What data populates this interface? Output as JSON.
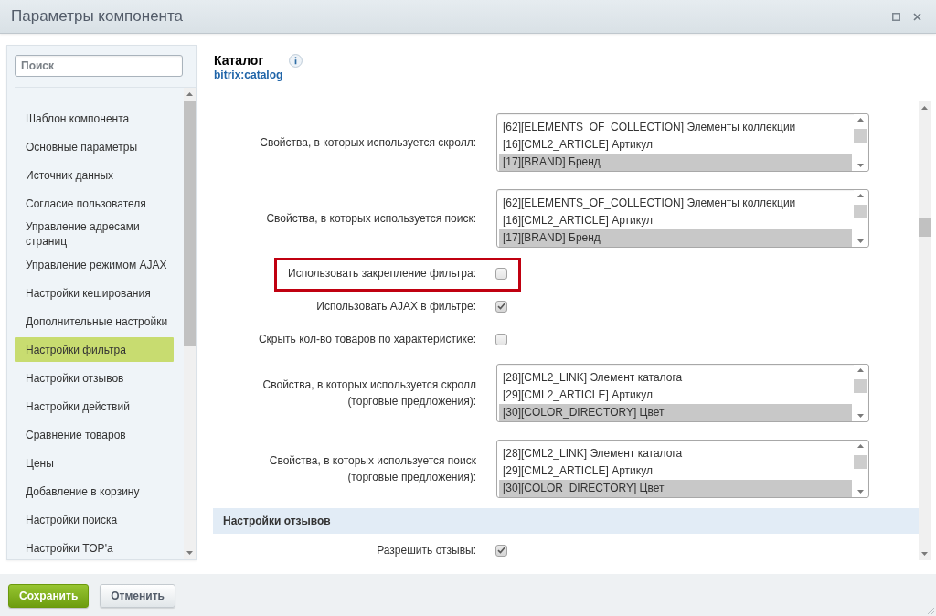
{
  "window": {
    "title": "Параметры компонента"
  },
  "sidebar": {
    "search": {
      "placeholder": "Поиск"
    },
    "items": [
      {
        "label": "Шаблон компонента",
        "selected": false
      },
      {
        "label": "Основные параметры",
        "selected": false
      },
      {
        "label": "Источник данных",
        "selected": false
      },
      {
        "label": "Согласие пользователя",
        "selected": false
      },
      {
        "label": "Управление адресами страниц",
        "selected": false
      },
      {
        "label": "Управление режимом AJAX",
        "selected": false
      },
      {
        "label": "Настройки кеширования",
        "selected": false
      },
      {
        "label": "Дополнительные настройки",
        "selected": false
      },
      {
        "label": "Настройки фильтра",
        "selected": true
      },
      {
        "label": "Настройки отзывов",
        "selected": false
      },
      {
        "label": "Настройки действий",
        "selected": false
      },
      {
        "label": "Сравнение товаров",
        "selected": false
      },
      {
        "label": "Цены",
        "selected": false
      },
      {
        "label": "Добавление в корзину",
        "selected": false
      },
      {
        "label": "Настройки поиска",
        "selected": false
      },
      {
        "label": "Настройки TOP'a",
        "selected": false
      }
    ]
  },
  "header": {
    "title": "Каталог",
    "code": "bitrix:catalog"
  },
  "settings": [
    {
      "kind": "listbox",
      "label": "Свойства, в которых используется скролл:",
      "highlighted": false,
      "options": [
        {
          "text": "[62][ELEMENTS_OF_COLLECTION] Элементы коллекции",
          "selected": false
        },
        {
          "text": "[16][CML2_ARTICLE] Артикул",
          "selected": false
        },
        {
          "text": "[17][BRAND] Бренд",
          "selected": true
        }
      ]
    },
    {
      "kind": "listbox",
      "label": "Свойства, в которых используется поиск:",
      "highlighted": false,
      "options": [
        {
          "text": "[62][ELEMENTS_OF_COLLECTION] Элементы коллекции",
          "selected": false
        },
        {
          "text": "[16][CML2_ARTICLE] Артикул",
          "selected": false
        },
        {
          "text": "[17][BRAND] Бренд",
          "selected": true
        }
      ]
    },
    {
      "kind": "checkbox",
      "label": "Использовать закрепление фильтра:",
      "checked": false,
      "highlighted": true
    },
    {
      "kind": "checkbox",
      "label": "Использовать AJAX в фильтре:",
      "checked": true,
      "highlighted": false
    },
    {
      "kind": "checkbox",
      "label": "Скрыть кол-во товаров по характеристике:",
      "checked": false,
      "highlighted": false
    },
    {
      "kind": "listbox",
      "label": "Свойства, в которых используется скролл (торговые предложения):",
      "highlighted": false,
      "options": [
        {
          "text": "[28][CML2_LINK] Элемент каталога",
          "selected": false
        },
        {
          "text": "[29][CML2_ARTICLE] Артикул",
          "selected": false
        },
        {
          "text": "[30][COLOR_DIRECTORY] Цвет",
          "selected": true
        }
      ]
    },
    {
      "kind": "listbox",
      "label": "Свойства, в которых используется поиск (торговые предложения):",
      "highlighted": false,
      "options": [
        {
          "text": "[28][CML2_LINK] Элемент каталога",
          "selected": false
        },
        {
          "text": "[29][CML2_ARTICLE] Артикул",
          "selected": false
        },
        {
          "text": "[30][COLOR_DIRECTORY] Цвет",
          "selected": true
        }
      ]
    },
    {
      "kind": "section",
      "label": "Настройки отзывов",
      "highlighted": false
    },
    {
      "kind": "checkbox",
      "label": "Разрешить отзывы:",
      "checked": true,
      "highlighted": false
    }
  ],
  "buttons": [
    {
      "label": "Сохранить",
      "kind": "primary"
    },
    {
      "label": "Отменить",
      "kind": "secondary"
    }
  ]
}
